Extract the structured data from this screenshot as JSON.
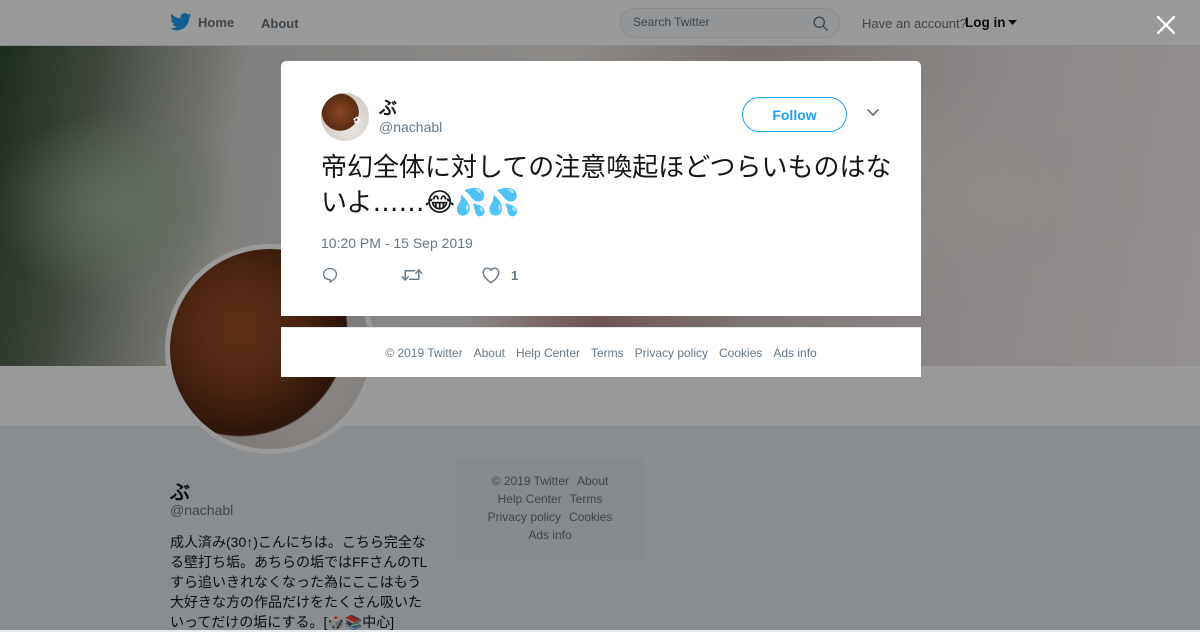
{
  "header": {
    "home_label": "Home",
    "about_label": "About",
    "search_placeholder": "Search Twitter",
    "account_prompt": "Have an account?",
    "login_label": "Log in"
  },
  "profile": {
    "name": "ぶ",
    "handle": "@nachabl",
    "bio": "成人済み(30↑)こんにちは。こちら完全なる壁打ち垢。あちらの垢ではFFさんのTLすら追いきれなくなった為にここはもう大好きな方の作品だけをたくさん吸いたいってだけの垢にする。[🎲📚中心]",
    "footer_links": [
      "© 2019 Twitter",
      "About",
      "Help Center",
      "Terms",
      "Privacy policy",
      "Cookies",
      "Ads info"
    ]
  },
  "tweet": {
    "author_name": "ぶ",
    "author_handle": "@nachabl",
    "follow_label": "Follow",
    "text": "帝幻全体に対しての注意喚起ほどつらいものはないよ……",
    "emojis": "😂💦💦",
    "timestamp": "10:20 PM - 15 Sep 2019",
    "like_count": "1"
  },
  "modal_footer": {
    "links": [
      "© 2019 Twitter",
      "About",
      "Help Center",
      "Terms",
      "Privacy policy",
      "Cookies",
      "Ads info"
    ]
  },
  "colors": {
    "accent": "#1da1f2",
    "secondary_text": "#657786",
    "overlay": "rgba(0,0,0,0.4)"
  },
  "icons": [
    "twitter-bird-icon",
    "search-icon",
    "caret-down-icon",
    "close-icon",
    "chevron-down-icon",
    "reply-icon",
    "retweet-icon",
    "like-icon"
  ]
}
